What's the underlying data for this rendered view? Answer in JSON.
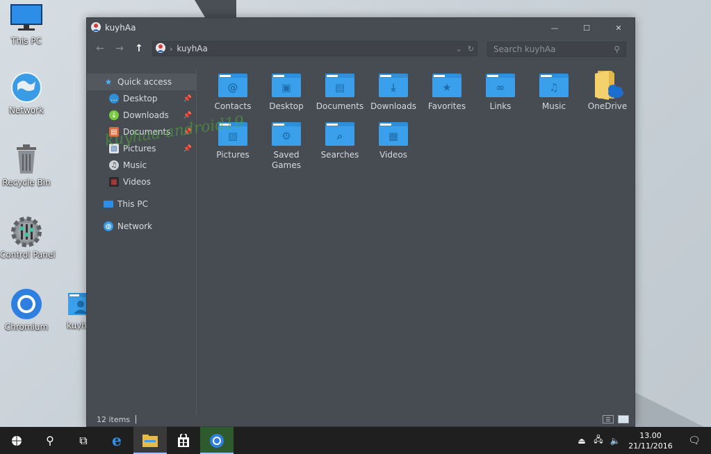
{
  "desktop": {
    "icons": [
      {
        "label": "This PC"
      },
      {
        "label": "Network"
      },
      {
        "label": "Recycle Bin"
      },
      {
        "label": "Control Panel"
      },
      {
        "label": "Chromium"
      },
      {
        "label": "kuyhA"
      }
    ]
  },
  "window": {
    "title": "kuyhAa",
    "address_path": "kuyhAa",
    "search_placeholder": "Search kuyhAa",
    "status": "12 items"
  },
  "sidebar": {
    "quick_access": "Quick access",
    "items": [
      {
        "label": "Desktop",
        "icon": "desktop-icon",
        "pinned": true
      },
      {
        "label": "Downloads",
        "icon": "download-icon",
        "pinned": true
      },
      {
        "label": "Documents",
        "icon": "documents-icon",
        "pinned": true
      },
      {
        "label": "Pictures",
        "icon": "pictures-icon",
        "pinned": true
      },
      {
        "label": "Music",
        "icon": "music-icon",
        "pinned": false
      },
      {
        "label": "Videos",
        "icon": "videos-icon",
        "pinned": false
      }
    ],
    "this_pc": "This PC",
    "network": "Network"
  },
  "folders": [
    {
      "label": "Contacts",
      "glyph": "@"
    },
    {
      "label": "Desktop",
      "glyph": "▣"
    },
    {
      "label": "Documents",
      "glyph": "▤"
    },
    {
      "label": "Downloads",
      "glyph": "⤓"
    },
    {
      "label": "Favorites",
      "glyph": "★"
    },
    {
      "label": "Links",
      "glyph": "∞"
    },
    {
      "label": "Music",
      "glyph": "♫"
    },
    {
      "label": "OneDrive",
      "glyph": "☁"
    },
    {
      "label": "Pictures",
      "glyph": "▧"
    },
    {
      "label": "Saved Games",
      "glyph": "⚙"
    },
    {
      "label": "Searches",
      "glyph": "⌕"
    },
    {
      "label": "Videos",
      "glyph": "▦"
    }
  ],
  "watermark": "kuyhaa-android19",
  "taskbar": {
    "time": "13.00",
    "date": "21/11/2016"
  },
  "colors": {
    "window_bg": "#474b52",
    "folder_blue": "#3aa0ec",
    "taskbar_bg": "#1f1f1f"
  }
}
